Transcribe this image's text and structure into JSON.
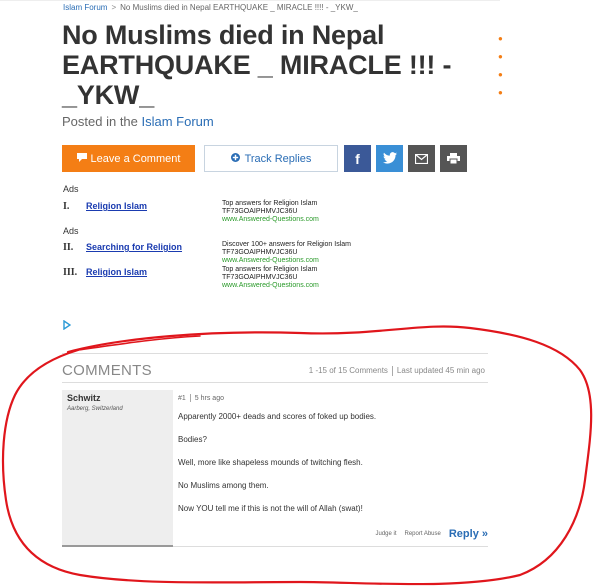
{
  "breadcrumb": {
    "forum": "Islam Forum",
    "separator": ">",
    "current": "No Muslims died in Nepal EARTHQUAKE _ MIRACLE !!!! - _YKW_"
  },
  "title": "No Muslims died in Nepal EARTHQUAKE _ MIRACLE !!! - _YKW_",
  "posted": {
    "prefix": "Posted in the",
    "forum": "Islam Forum"
  },
  "buttons": {
    "leave_comment": "Leave a Comment",
    "track_replies": "Track Replies",
    "facebook": "f"
  },
  "ads": [
    {
      "label": "Ads",
      "items": [
        {
          "num": "I.",
          "link": "Religion Islam",
          "desc1": "Top answers for Religion Islam",
          "desc2": "TF73GOAIPHMVJC36U",
          "url": "www.Answered-Questions.com"
        }
      ]
    },
    {
      "label": "Ads",
      "items": [
        {
          "num": "II.",
          "link": "Searching for Religion",
          "desc1": "Discover 100+ answers for Religion Islam",
          "desc2": "TF73GOAIPHMVJC36U",
          "url": "www.Answered-Questions.com"
        },
        {
          "num": "III.",
          "link": "Religion Islam",
          "desc1": "Top answers for Religion Islam",
          "desc2": "TF73GOAIPHMVJC36U",
          "url": "www.Answered-Questions.com"
        }
      ]
    }
  ],
  "comments": {
    "title": "COMMENTS",
    "range": "1 -15 of 15 Comments",
    "updated": "Last updated 45 min ago",
    "items": [
      {
        "user": "Schwitz",
        "location": "Aarberg, Switzerland",
        "num": "#1",
        "age": "5 hrs ago",
        "lines": [
          "Apparently 2000+ deads and scores of foked up bodies.",
          "Bodies?",
          "Well, more like shapeless mounds of twitching flesh.",
          "No Muslims among them.",
          "Now YOU tell me if this is not the will of Allah (swat)!"
        ],
        "judge": "Judge it",
        "report": "Report Abuse",
        "reply": "Reply »"
      }
    ]
  },
  "colors": {
    "accent": "#f47e15",
    "link": "#2a6db5",
    "annotation": "#e0161c"
  }
}
